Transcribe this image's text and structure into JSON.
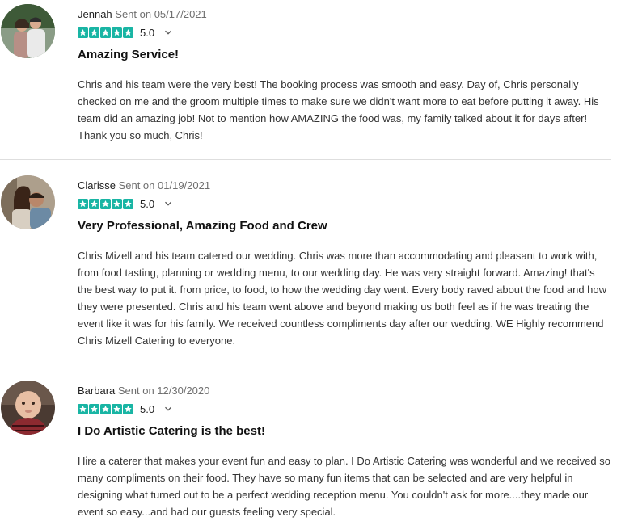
{
  "reviews": [
    {
      "author": "Jennah",
      "sent_prefix": " Sent on ",
      "date": "05/17/2021",
      "rating": "5.0",
      "stars": 5,
      "title": "Amazing Service!",
      "body": "Chris and his team were the very best! The booking process was smooth and easy. Day of, Chris personally checked on me and the groom multiple times to make sure we didn't want more to eat before putting it away. His team did an amazing job! Not to mention how AMAZING the food was, my family talked about it for days after! Thank you so much, Chris!"
    },
    {
      "author": "Clarisse",
      "sent_prefix": " Sent on ",
      "date": "01/19/2021",
      "rating": "5.0",
      "stars": 5,
      "title": "Very Professional, Amazing Food and Crew",
      "body": "Chris Mizell and his team catered our wedding. Chris was more than accommodating and pleasant to work with, from food tasting, planning or wedding menu, to our wedding day. He was very straight forward. Amazing! that's the best way to put it. from price, to food, to how the wedding day went. Every body raved about the food and how they were presented. Chris and his team went above and beyond making us both feel as if he was treating the event like it was for his family. We received countless compliments day after our wedding. WE Highly recommend Chris Mizell Catering to everyone."
    },
    {
      "author": "Barbara",
      "sent_prefix": " Sent on ",
      "date": "12/30/2020",
      "rating": "5.0",
      "stars": 5,
      "title": "I Do Artistic Catering is the best!",
      "body": "Hire a caterer that makes your event fun and easy to plan. I Do Artistic Catering was wonderful and we received so many compliments on their food. They have so many fun items that can be selected and are very helpful in designing what turned out to be a perfect wedding reception menu. You couldn't ask for more....they made our event so easy...and had our guests feeling very special."
    }
  ],
  "colors": {
    "star": "#19b5a4",
    "divider": "#dedede",
    "meta": "#6f6f6f",
    "text": "#333333"
  },
  "icons": {
    "star": "star-icon",
    "expand": "chevron-down-icon"
  }
}
